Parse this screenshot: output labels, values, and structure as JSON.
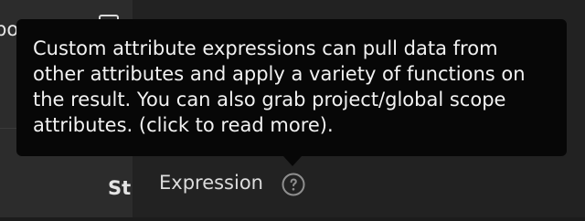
{
  "left_panel": {
    "top_text_fragment": "po",
    "bottom_label_fragment": "St"
  },
  "field": {
    "label": "Expression",
    "help_icon": "question-circle-icon"
  },
  "tooltip": {
    "text": "Custom attribute expressions can pull data from other attributes and apply a variety of functions on the result. You can also grab project/global scope attributes. (click to read more)."
  },
  "colors": {
    "tooltip_bg": "#070707",
    "tooltip_text": "#f2f2f2",
    "panel_bg": "#222222",
    "left_panel_bg": "#2c2c2c"
  }
}
